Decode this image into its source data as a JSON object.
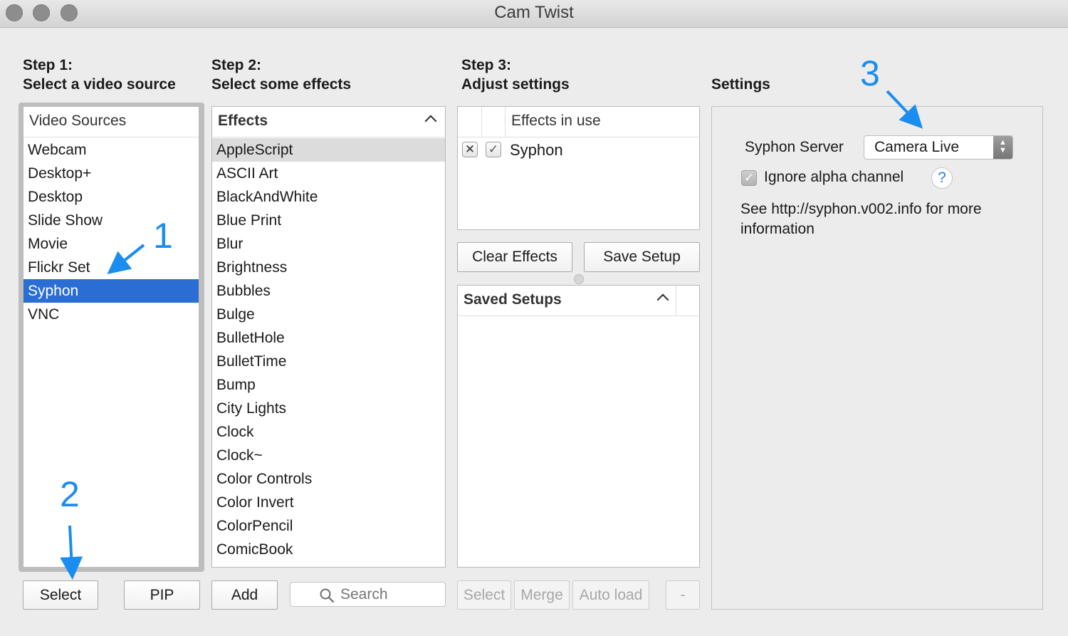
{
  "window": {
    "title": "Cam Twist"
  },
  "steps": {
    "step1": "Step 1:\nSelect a video source",
    "step2": "Step 2:\nSelect some effects",
    "step3": "Step 3:\nAdjust settings",
    "settings": "Settings"
  },
  "video_sources": {
    "header": "Video Sources",
    "items": [
      "Webcam",
      "Desktop+",
      "Desktop",
      "Slide Show",
      "Movie",
      "Flickr Set",
      "Syphon",
      "VNC"
    ],
    "selected": "Syphon"
  },
  "effects": {
    "header": "Effects",
    "items": [
      "AppleScript",
      "ASCII Art",
      "BlackAndWhite",
      "Blue Print",
      "Blur",
      "Brightness",
      "Bubbles",
      "Bulge",
      "BulletHole",
      "BulletTime",
      "Bump",
      "City Lights",
      "Clock",
      "Clock~",
      "Color Controls",
      "Color Invert",
      "ColorPencil",
      "ComicBook"
    ],
    "highlighted": "AppleScript"
  },
  "effects_in_use": {
    "header": "Effects in use",
    "items": [
      {
        "name": "Syphon",
        "enabled": true
      }
    ]
  },
  "saved_setups": {
    "header": "Saved Setups"
  },
  "buttons": {
    "select": "Select",
    "pip": "PIP",
    "add": "Add",
    "clear_effects": "Clear Effects",
    "save_setup": "Save Setup",
    "setups_select": "Select",
    "merge": "Merge",
    "auto_load": "Auto load",
    "remove": "-"
  },
  "search": {
    "placeholder": "Search"
  },
  "settings_panel": {
    "syphon_server_label": "Syphon Server",
    "syphon_server_value": "Camera Live",
    "ignore_alpha_label": "Ignore alpha channel",
    "ignore_alpha_checked": true,
    "help": "?",
    "info_text": "See http://syphon.v002.info for more information"
  },
  "annotations": [
    "1",
    "2",
    "3"
  ],
  "colors": {
    "selection": "#2a6ed4",
    "annotation": "#1a8df0"
  }
}
